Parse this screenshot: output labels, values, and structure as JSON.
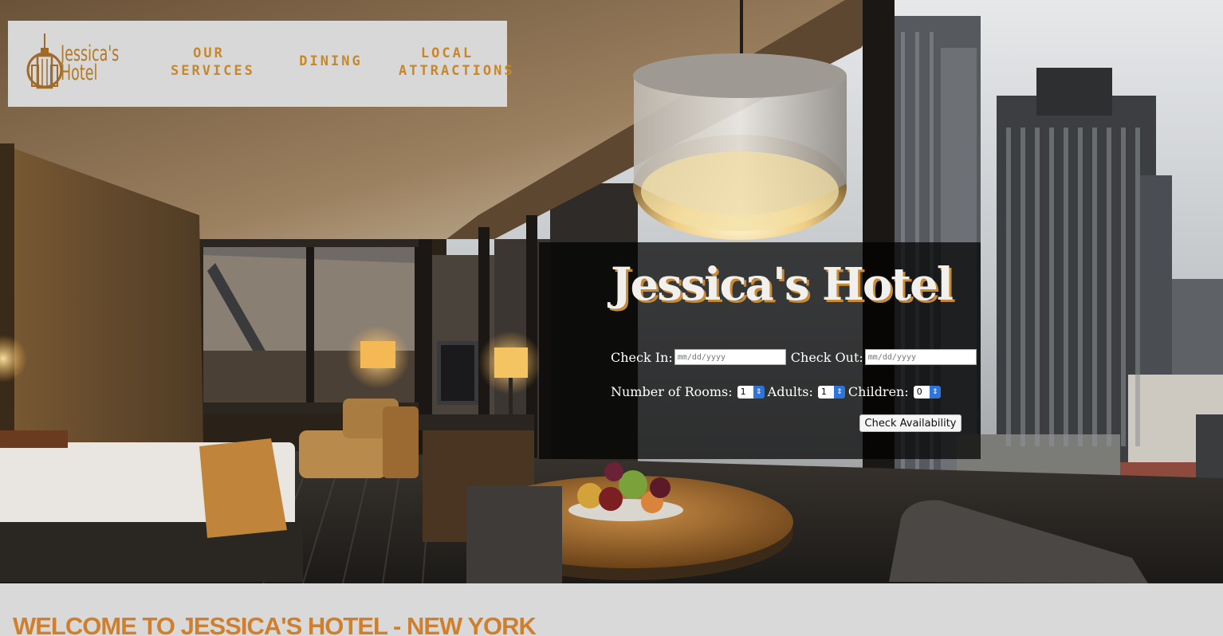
{
  "brand": {
    "logo_line1": "Jessica's",
    "logo_line2": "Hotel"
  },
  "nav": {
    "items": [
      {
        "line1": "OUR",
        "line2": "SERVICES"
      },
      {
        "line1": "DINING",
        "line2": ""
      },
      {
        "line1": "LOCAL",
        "line2": "ATTRACTIONS"
      }
    ]
  },
  "booking": {
    "title": "Jessica's Hotel",
    "check_in_label": "Check In:",
    "check_in_placeholder": "mm/dd/yyyy",
    "check_out_label": "Check Out:",
    "check_out_placeholder": "mm/dd/yyyy",
    "rooms_label": "Number of Rooms:",
    "rooms_value": "1",
    "adults_label": "Adults:",
    "adults_value": "1",
    "children_label": "Children:",
    "children_value": "0",
    "submit_label": "Check Availability"
  },
  "welcome": {
    "heading": "WELCOME TO JESSICA'S HOTEL - NEW YORK"
  },
  "colors": {
    "accent": "#c7872b",
    "nav_bg": "#d8d8d8",
    "panel_bg": "#000000",
    "stepper_blue": "#2f74d9"
  },
  "icons": [
    "skyscraper-logo-icon",
    "stepper-arrows-icon"
  ]
}
